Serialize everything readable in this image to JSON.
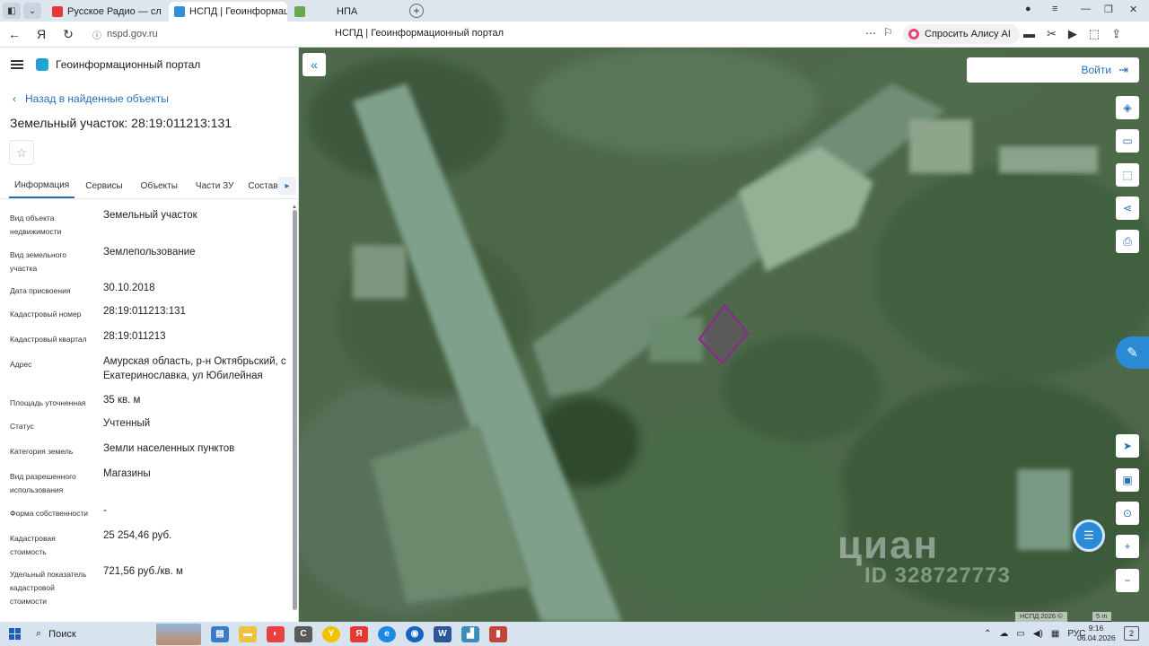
{
  "browser": {
    "tabs": [
      {
        "title": "Русское Радио — сл",
        "active": false,
        "favicon_color": "#e53935",
        "audio_icon": "speaker-icon"
      },
      {
        "title": "НСПД | Геоинформаци",
        "active": true,
        "favicon_color": "#2f8fd8"
      },
      {
        "title": "НПА",
        "active": false,
        "favicon_color": "#6aa84f"
      }
    ],
    "url": "nspd.gov.ru",
    "page_title": "НСПД | Геоинформационный портал",
    "alice_label": "Спросить Алису AI"
  },
  "panel": {
    "portal_name": "Геоинформационный портал",
    "back_link": "Назад в найденные объекты",
    "object_title": "Земельный участок: 28:19:011213:131",
    "tabs": [
      {
        "label": "Информация",
        "active": true
      },
      {
        "label": "Сервисы",
        "active": false
      },
      {
        "label": "Объекты",
        "active": false
      },
      {
        "label": "Части ЗУ",
        "active": false
      },
      {
        "label": "Состав",
        "active": false
      }
    ],
    "properties": [
      {
        "label": "Вид объекта недвижимости",
        "value": "Земельный участок"
      },
      {
        "label": "Вид земельного участка",
        "value": "Землепользование"
      },
      {
        "label": "Дата присвоения",
        "value": "30.10.2018"
      },
      {
        "label": "Кадастровый номер",
        "value": "28:19:011213:131"
      },
      {
        "label": "Кадастровый квартал",
        "value": "28:19:011213"
      },
      {
        "label": "Адрес",
        "value": "Амурская область, р-н Октябрьский, с Екатеринославка, ул Юбилейная"
      },
      {
        "label": "Площадь уточненная",
        "value": "35 кв. м"
      },
      {
        "label": "Статус",
        "value": "Учтенный"
      },
      {
        "label": "Категория земель",
        "value": "Земли населенных пунктов"
      },
      {
        "label": "Вид разрешенного использования",
        "value": "Магазины"
      },
      {
        "label": "Форма собственности",
        "value": "-"
      },
      {
        "label": "Кадастровая стоимость",
        "value": "25 254,46 руб."
      },
      {
        "label": "Удельный показатель кадастровой стоимости",
        "value": "721,56 руб./кв. м"
      }
    ]
  },
  "map": {
    "login_label": "Войти",
    "watermark_logo": "циан",
    "watermark_id": "ID 328727773",
    "copyright": "НСПД 2026 ©",
    "scale_label": "5 m",
    "parcel_color": "#8a2a8c"
  },
  "taskbar": {
    "search_label": "Поиск",
    "language": "РУС",
    "time": "9:16",
    "date": "06.04.2026",
    "notifications": "2"
  },
  "colors": {
    "accent": "#2a6fb5",
    "chat_button": "#2a8ad6"
  }
}
